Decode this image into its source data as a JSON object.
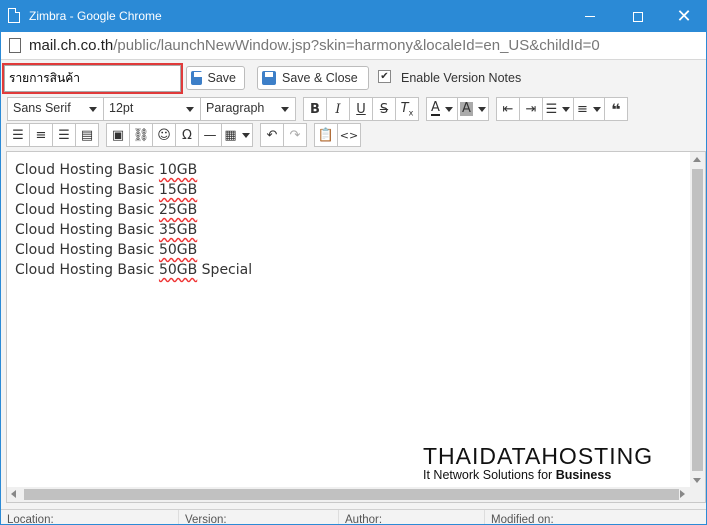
{
  "window": {
    "title": "Zimbra - Google Chrome",
    "url_host": "mail.ch.co.th",
    "url_rest": "/public/launchNewWindow.jsp?skin=harmony&localeId=en_US&childId=0"
  },
  "compose": {
    "subject_value": "รายการสินค้า",
    "save_label": "Save",
    "save_close_label": "Save & Close",
    "version_notes_label": "Enable Version Notes",
    "version_notes_checked": true
  },
  "formatting": {
    "font_family": "Sans Serif",
    "font_size": "12pt",
    "block_format": "Paragraph"
  },
  "editor": {
    "lines": [
      {
        "prefix": "Cloud Hosting Basic ",
        "size": "10GB",
        "suffix": ""
      },
      {
        "prefix": "Cloud Hosting Basic ",
        "size": "15GB",
        "suffix": ""
      },
      {
        "prefix": "Cloud Hosting Basic ",
        "size": "25GB",
        "suffix": ""
      },
      {
        "prefix": "Cloud Hosting Basic ",
        "size": "35GB",
        "suffix": ""
      },
      {
        "prefix": "Cloud Hosting Basic ",
        "size": "50GB",
        "suffix": ""
      },
      {
        "prefix": "Cloud Hosting Basic ",
        "size": "50GB",
        "suffix": " Special"
      }
    ]
  },
  "logo": {
    "brand": "THAIDATAHOSTING",
    "tag_plain": "It Network Solutions for ",
    "tag_bold": "Business"
  },
  "footer": {
    "location": "Location:",
    "version": "Version:",
    "author": "Author:",
    "modified": "Modified on:"
  },
  "colors": {
    "titlebar": "#2b8ad6",
    "subject_highlight": "#e03a3a"
  }
}
